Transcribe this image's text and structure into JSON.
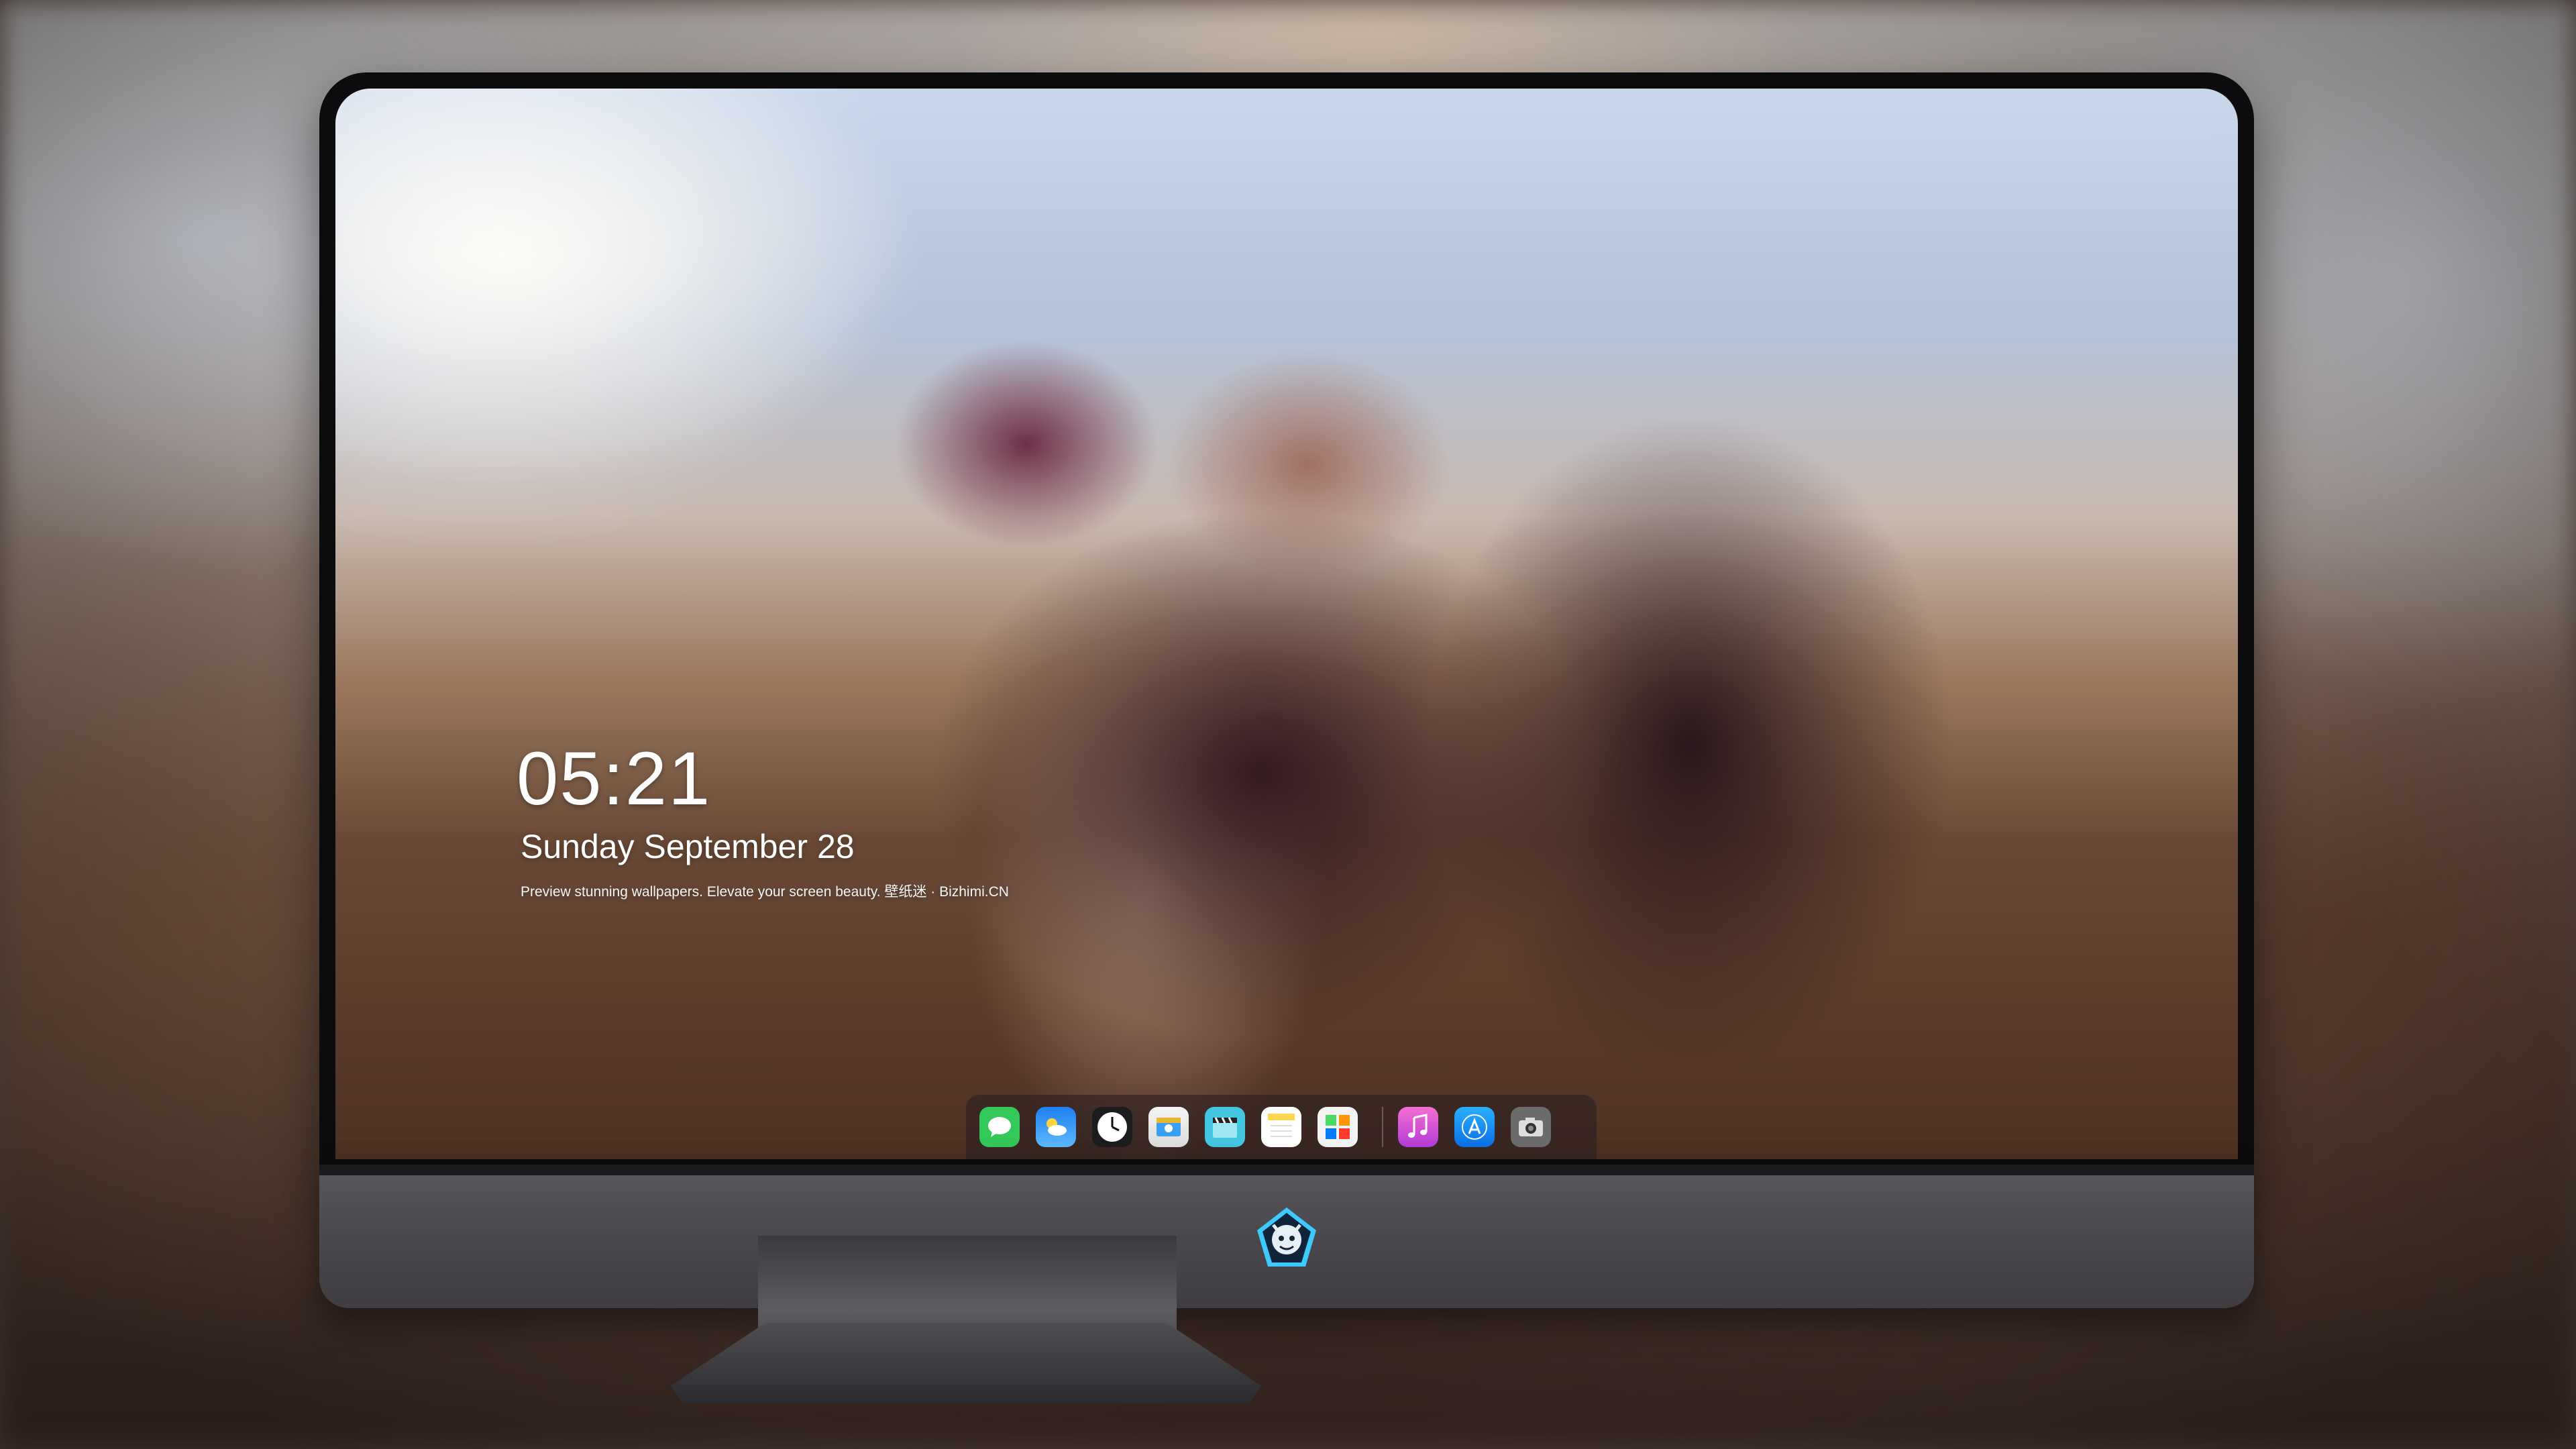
{
  "lockscreen": {
    "time": "05:21",
    "date": "Sunday September  28",
    "caption": "Preview stunning wallpapers. Elevate your screen beauty. 壁纸迷 · Bizhimi.CN"
  },
  "dock": {
    "items": [
      {
        "name": "Messages",
        "icon": "speech-bubble-icon",
        "color": "#34c759"
      },
      {
        "name": "Weather",
        "icon": "weather-icon",
        "color": "#2e8ef5"
      },
      {
        "name": "Clock",
        "icon": "clock-icon",
        "color": "#ffffff"
      },
      {
        "name": "Preview",
        "icon": "preview-icon",
        "color": "#e9b832"
      },
      {
        "name": "Final Cut",
        "icon": "clapperboard-icon",
        "color": "#43c6e0"
      },
      {
        "name": "Notes",
        "icon": "notes-icon",
        "color": "#ffd84d"
      },
      {
        "name": "Photo Booth",
        "icon": "photo-grid-icon",
        "color": "#f3f3f3"
      },
      {
        "name": "Music",
        "icon": "music-note-icon",
        "color": "#e754c8"
      },
      {
        "name": "App Store",
        "icon": "app-store-icon",
        "color": "#1a8cf3"
      },
      {
        "name": "Camera",
        "icon": "camera-icon",
        "color": "#6b6b6b"
      }
    ]
  },
  "colors": {
    "bezel": "#0c0c0e",
    "chin": "#4a484c",
    "text": "#ffffff"
  }
}
